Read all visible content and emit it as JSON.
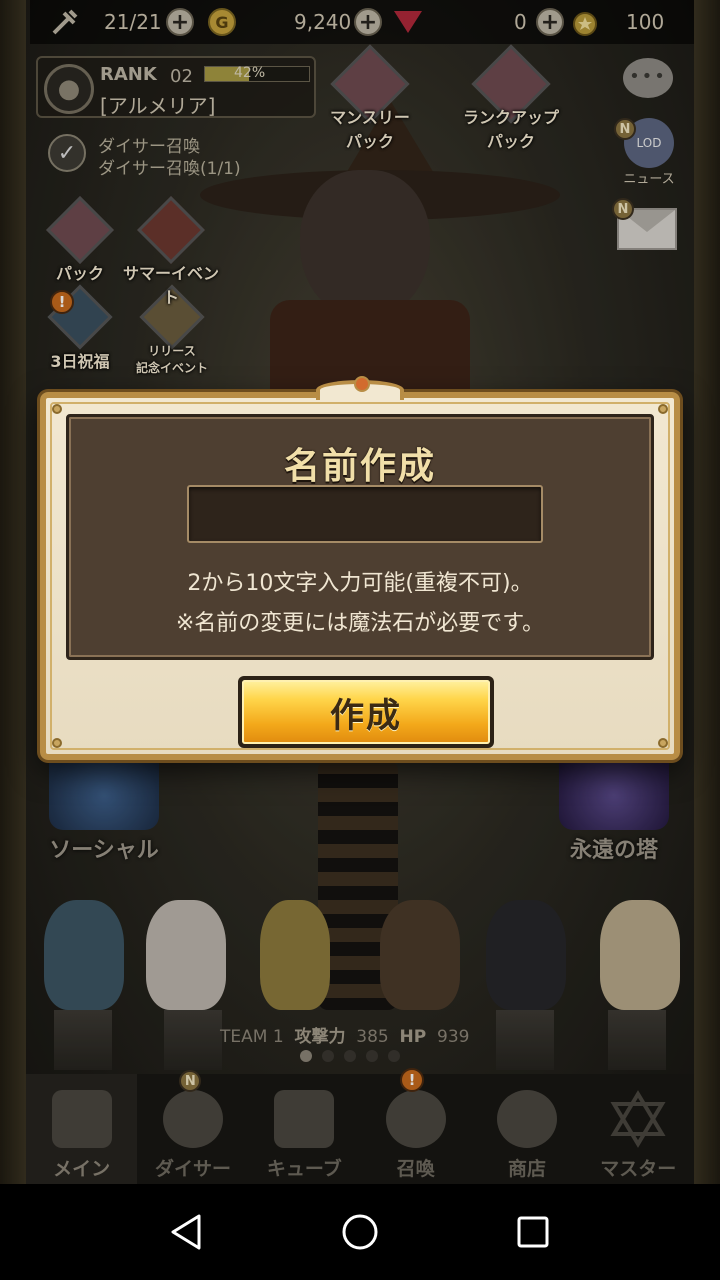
{
  "topbar": {
    "stamina": "21/21",
    "gold": "9,240",
    "gems": "0",
    "points": "100",
    "coin_letter": "G"
  },
  "rank": {
    "label": "RANK",
    "level": "02",
    "progress_text": "42%",
    "progress_fraction": 0.42,
    "player_name": "[アルメリア]"
  },
  "quest": {
    "line1": "ダイサー召喚",
    "line2": "ダイサー召喚(1/1)"
  },
  "events": [
    {
      "label": "マンスリー\nパック"
    },
    {
      "label": "ランクアップ\nパック"
    },
    {
      "label": "パック"
    },
    {
      "label": "サマーイベント"
    },
    {
      "label": "3日祝福"
    },
    {
      "label": "リリース\n記念イベント"
    }
  ],
  "side": {
    "news_label": "ニュース",
    "lod_label": "LOD",
    "badge_n": "N"
  },
  "modes": {
    "social": "ソーシャル",
    "tower": "永遠の塔"
  },
  "team": {
    "label": "TEAM 1",
    "attack_label": "攻撃力",
    "attack": "385",
    "hp_label": "HP",
    "hp": "939"
  },
  "nav": [
    {
      "label": "メイン"
    },
    {
      "label": "ダイサー"
    },
    {
      "label": "キューブ"
    },
    {
      "label": "召喚"
    },
    {
      "label": "商店"
    },
    {
      "label": "マスター"
    }
  ],
  "dialog": {
    "title": "名前作成",
    "input_value": "",
    "input_placeholder": "",
    "hint1": "2から10文字入力可能(重複不可)。",
    "hint2": "※名前の変更には魔法石が必要です。",
    "create_label": "作成"
  },
  "badges": {
    "alert": "!"
  },
  "colors": {
    "button_gold": "#f3a81a",
    "dialog_frame": "#b88d45",
    "dialog_inner": "#4e3f31"
  }
}
